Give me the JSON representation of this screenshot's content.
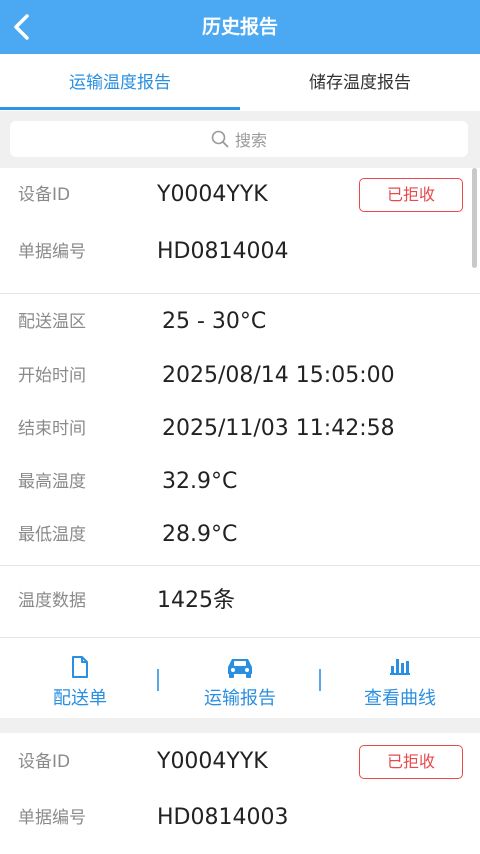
{
  "header": {
    "title": "历史报告"
  },
  "tabs": [
    {
      "label": "运输温度报告",
      "active": true
    },
    {
      "label": "储存温度报告",
      "active": false
    }
  ],
  "search": {
    "placeholder": "搜索"
  },
  "reports": [
    {
      "device_id_label": "设备ID",
      "device_id": "Y0004YYK",
      "status": "已拒收",
      "doc_no_label": "单据编号",
      "doc_no": "HD0814004",
      "zone_label": "配送温区",
      "zone": "25 - 30°C",
      "start_label": "开始时间",
      "start": "2025/08/14 15:05:00",
      "end_label": "结束时间",
      "end": "2025/11/03 11:42:58",
      "max_label": "最高温度",
      "max": "32.9°C",
      "min_label": "最低温度",
      "min": "28.9°C",
      "data_label": "温度数据",
      "data_count": "1425条",
      "actions": [
        "配送单",
        "运输报告",
        "查看曲线"
      ]
    },
    {
      "device_id_label": "设备ID",
      "device_id": "Y0004YYK",
      "status": "已拒收",
      "doc_no_label": "单据编号",
      "doc_no": "HD0814003"
    }
  ],
  "colors": {
    "header": "#4aa9f2",
    "accent": "#2a8fe0",
    "reject": "#e84a4a"
  }
}
